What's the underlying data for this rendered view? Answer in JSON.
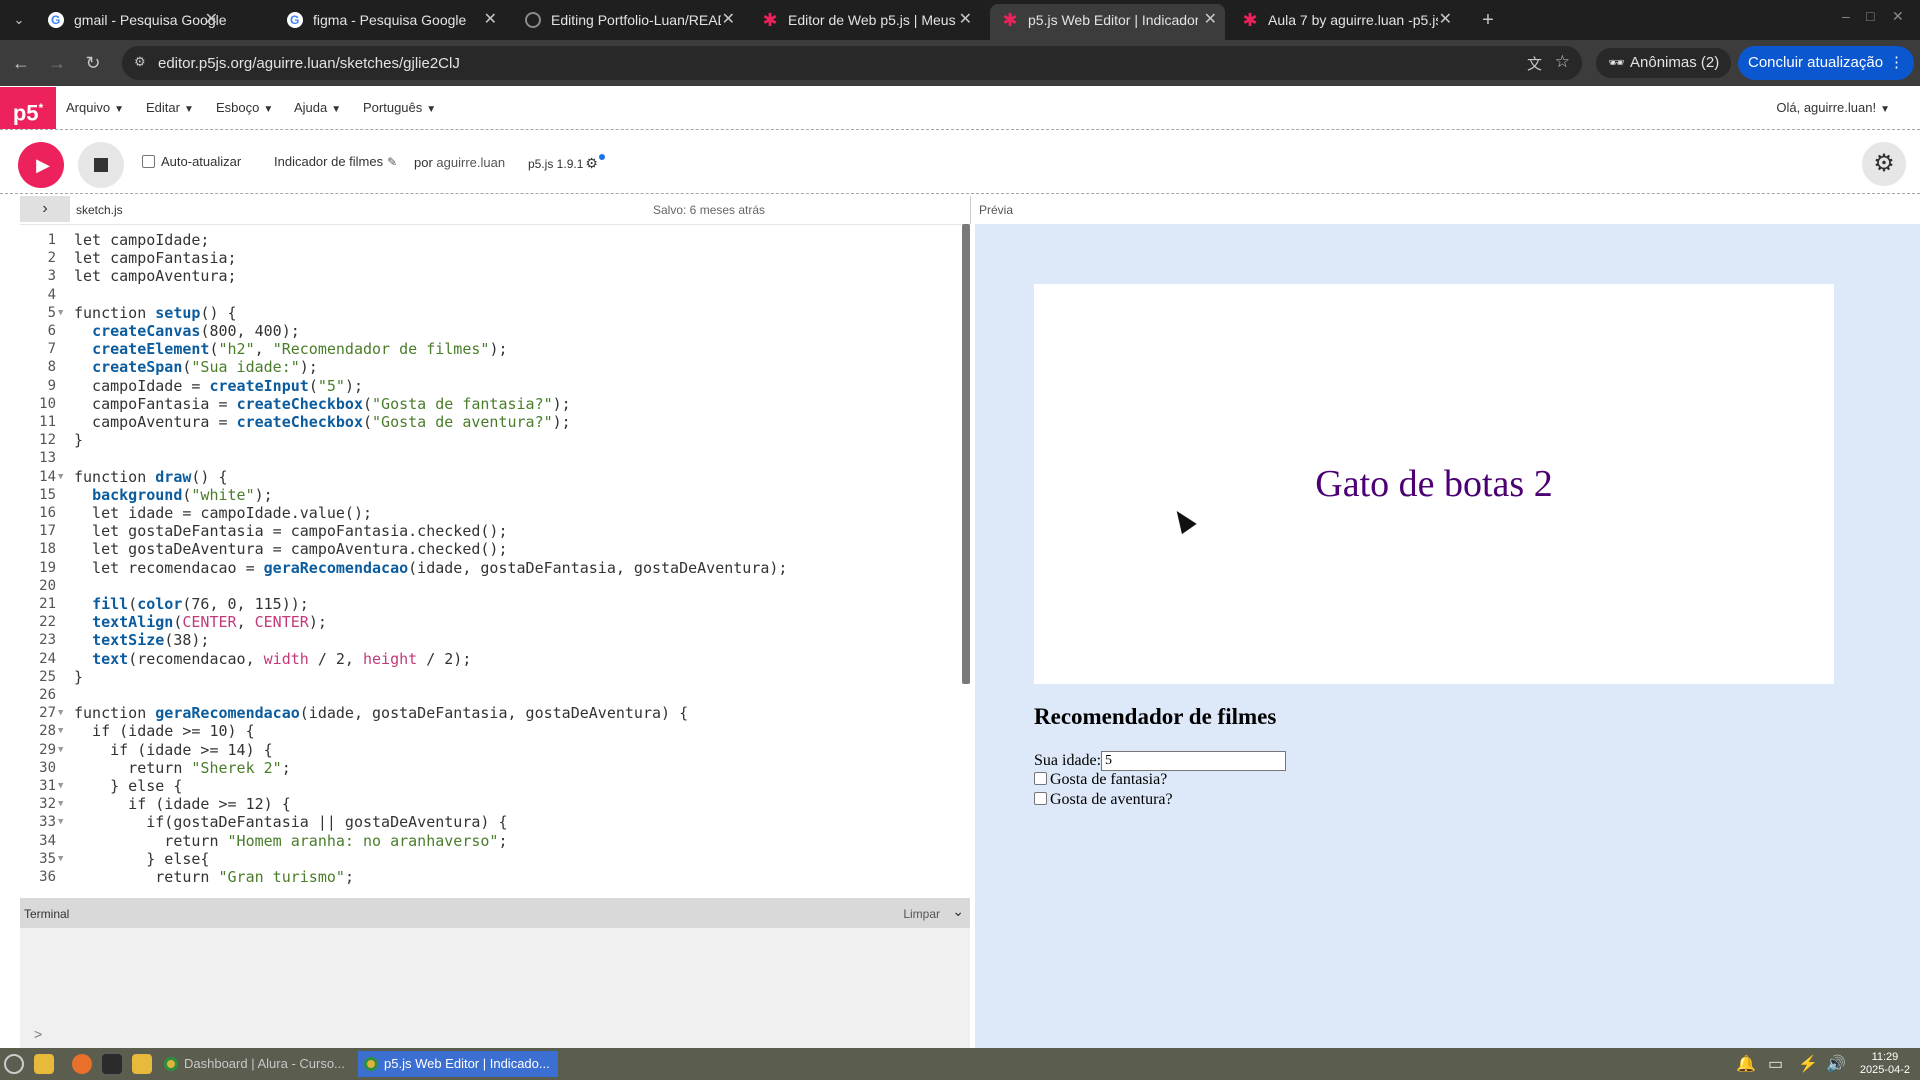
{
  "browser": {
    "tabs": [
      {
        "title": "gmail - Pesquisa Google",
        "icon": "google-icon"
      },
      {
        "title": "figma - Pesquisa Google",
        "icon": "google-icon"
      },
      {
        "title": "Editing Portfolio-Luan/READ",
        "icon": "github-icon"
      },
      {
        "title": "Editor de Web p5.js | Meus e",
        "icon": "p5-star-icon"
      },
      {
        "title": "p5.js Web Editor | Indicador d",
        "icon": "p5-star-icon",
        "active": true
      },
      {
        "title": "Aula 7 by aguirre.luan -p5.js",
        "icon": "p5-star-icon"
      }
    ],
    "url": "editor.p5js.org/aguirre.luan/sketches/gjlie2ClJ",
    "incognito_label": "Anônimas (2)",
    "update_label": "Concluir atualização"
  },
  "p5": {
    "logo": "p5",
    "menu": [
      "Arquivo",
      "Editar",
      "Esboço",
      "Ajuda",
      "Português"
    ],
    "greeting": "Olá, aguirre.luan!",
    "toolbar": {
      "autorefresh_label": "Auto-atualizar",
      "sketch_name": "Indicador de filmes",
      "by_label": "por",
      "owner": "aguirre.luan",
      "version": "p5.js 1.9.1"
    },
    "editor": {
      "file_name": "sketch.js",
      "save_status": "Salvo: 6 meses atrás",
      "lines": [
        "let campoIdade;",
        "let campoFantasia;",
        "let campoAventura;",
        "",
        "function setup() {",
        "  createCanvas(800, 400);",
        "  createElement(\"h2\", \"Recomendador de filmes\");",
        "  createSpan(\"Sua idade:\");",
        "  campoIdade = createInput(\"5\");",
        "  campoFantasia = createCheckbox(\"Gosta de fantasia?\");",
        "  campoAventura = createCheckbox(\"Gosta de aventura?\");",
        "}",
        "",
        "function draw() {",
        "  background(\"white\");",
        "  let idade = campoIdade.value();",
        "  let gostaDeFantasia = campoFantasia.checked();",
        "  let gostaDeAventura = campoAventura.checked();",
        "  let recomendacao = geraRecomendacao(idade, gostaDeFantasia, gostaDeAventura);",
        "",
        "  fill(color(76, 0, 115));",
        "  textAlign(CENTER, CENTER);",
        "  textSize(38);",
        "  text(recomendacao, width / 2, height / 2);",
        "}",
        "",
        "function geraRecomendacao(idade, gostaDeFantasia, gostaDeAventura) {",
        "  if (idade >= 10) {",
        "    if (idade >= 14) {",
        "      return \"Sherek 2\";",
        "    } else {",
        "      if (idade >= 12) {",
        "        if(gostaDeFantasia || gostaDeAventura) {",
        "          return \"Homem aranha: no aranhaverso\";",
        "        } else{",
        "         return \"Gran turismo\";"
      ],
      "fold_lines": [
        5,
        14,
        27,
        28,
        29,
        31,
        32,
        33,
        35
      ]
    },
    "terminal": {
      "label": "Terminal",
      "clear_label": "Limpar",
      "prompt": ">"
    },
    "preview": {
      "label": "Prévia",
      "canvas_text": "Gato de botas 2",
      "canvas_text_color": "#4c0073",
      "heading": "Recomendador de filmes",
      "age_label": "Sua idade:",
      "age_value": "5",
      "fantasy_label": "Gosta de fantasia?",
      "adventure_label": "Gosta de aventura?"
    }
  },
  "taskbar": {
    "tasks": [
      "Dashboard | Alura - Curso...",
      "p5.js Web Editor | Indicado..."
    ],
    "clock_time": "11:29",
    "clock_date": "2025-04-2"
  },
  "colors": {
    "p5_pink": "#ed225d",
    "chrome_dark": "#1f1f1f",
    "update_blue": "#0b57d0",
    "preview_bg": "#dde8f9"
  }
}
